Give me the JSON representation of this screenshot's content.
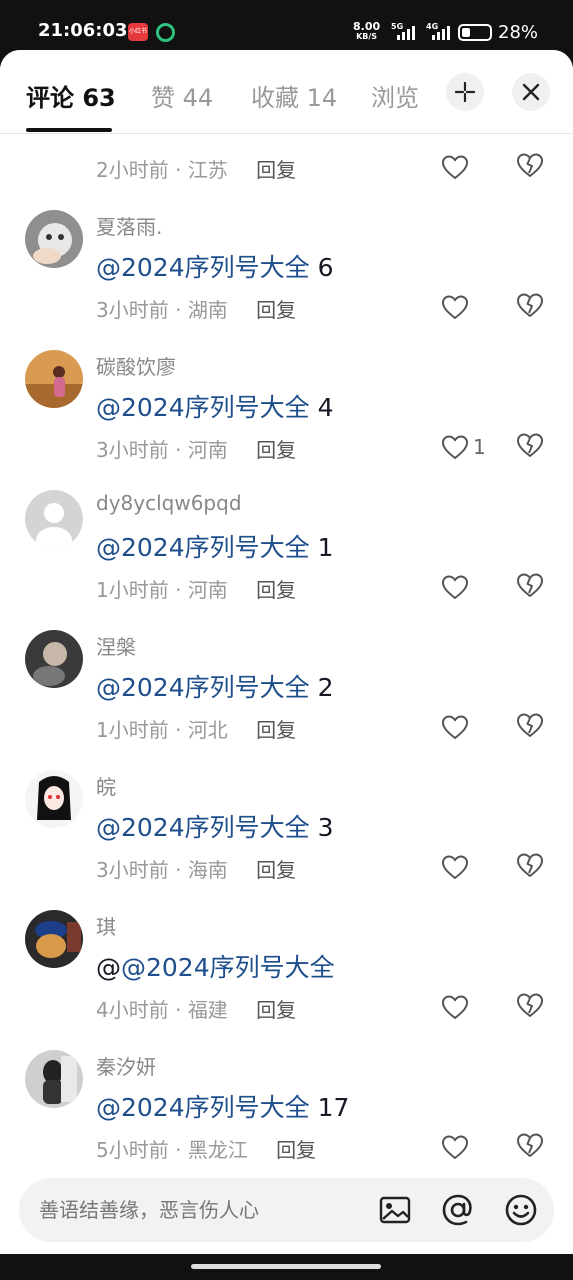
{
  "status": {
    "time": "21:06:03",
    "speed_value": "8.00",
    "speed_unit": "KB/S",
    "net1": "5G",
    "net2": "4G",
    "battery": "28%"
  },
  "tabs": [
    {
      "label": "评论 63",
      "active": true
    },
    {
      "label": "赞 44",
      "active": false
    },
    {
      "label": "收藏 14",
      "active": false
    },
    {
      "label": "浏览",
      "active": false
    }
  ],
  "comments": [
    {
      "user": "",
      "mention": "",
      "text": "",
      "time": "2小时前",
      "location": "江苏",
      "reply": "回复",
      "likes": "",
      "partial": true
    },
    {
      "user": "夏落雨.",
      "prefix": "",
      "mention": "@2024序列号大全",
      "text": " 6",
      "time": "3小时前",
      "location": "湖南",
      "reply": "回复",
      "likes": ""
    },
    {
      "user": "碳酸饮廖",
      "prefix": "",
      "mention": "@2024序列号大全",
      "text": " 4",
      "time": "3小时前",
      "location": "河南",
      "reply": "回复",
      "likes": "1"
    },
    {
      "user": "dy8yclqw6pqd",
      "prefix": "",
      "mention": "@2024序列号大全",
      "text": " 1",
      "time": "1小时前",
      "location": "河南",
      "reply": "回复",
      "likes": ""
    },
    {
      "user": "涅槃",
      "prefix": "",
      "mention": "@2024序列号大全",
      "text": " 2",
      "time": "1小时前",
      "location": "河北",
      "reply": "回复",
      "likes": ""
    },
    {
      "user": "皖",
      "prefix": "",
      "mention": "@2024序列号大全",
      "text": " 3",
      "time": "3小时前",
      "location": "海南",
      "reply": "回复",
      "likes": ""
    },
    {
      "user": "琪",
      "prefix": "@",
      "mention": "@2024序列号大全",
      "text": "",
      "time": "4小时前",
      "location": "福建",
      "reply": "回复",
      "likes": ""
    },
    {
      "user": "秦汐妍",
      "prefix": "",
      "mention": "@2024序列号大全",
      "text": " 17",
      "time": "5小时前",
      "location": "黑龙江",
      "reply": "回复",
      "likes": ""
    }
  ],
  "input": {
    "placeholder": "善语结善缘，恶言伤人心"
  },
  "colors": {
    "mention": "#1e4f8c",
    "accent_underline": "#111111"
  }
}
